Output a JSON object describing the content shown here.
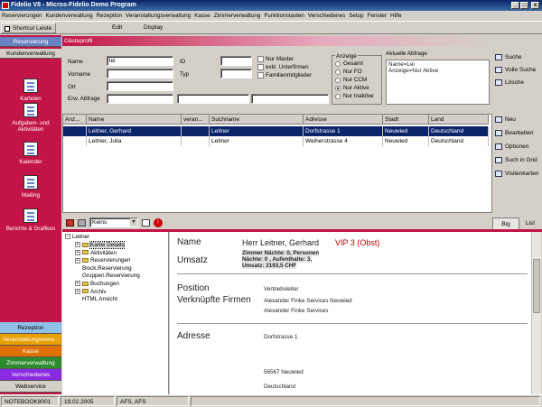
{
  "window": {
    "title": "Fidelio V8 - Micros-Fidelio Demo Program",
    "minimize": "_",
    "maximize": "□",
    "close": "x"
  },
  "menu": [
    "Reservierungen",
    "Kundenverwaltung",
    "Rezeption",
    "Veranstaltungsverwaltung",
    "Kasse",
    "Zimmerverwaltung",
    "Funktionstasten",
    "Verschiedenes",
    "Setup",
    "Fenster",
    "Hilfe"
  ],
  "toolbar": {
    "shortcut": "Shortcut Leiste",
    "edit": "Edit",
    "display": "Display"
  },
  "nav": {
    "top_tabs": [
      "Reservierung",
      "Kundenverwaltung"
    ],
    "items": [
      "Karteien",
      "Aufgaben- und Aktivitäten",
      "Kalender",
      "Mailing",
      "Berichte & Grafiken"
    ],
    "bottom_tabs": [
      {
        "label": "Rezeption",
        "color": "#8fc0e8"
      },
      {
        "label": "Veranstaltungsverw...",
        "color": "#e8a000"
      },
      {
        "label": "Kasse",
        "color": "#e07000"
      },
      {
        "label": "Zimmerverwaltung",
        "color": "#2e8b2e"
      },
      {
        "label": "Verschiedenes",
        "color": "#8a2be2"
      },
      {
        "label": "Webservice",
        "color": "#d4d0c8"
      }
    ]
  },
  "panel": {
    "title": "Gästeprofil"
  },
  "form": {
    "name_label": "Name",
    "name_value": "lei",
    "vorname_label": "Vorname",
    "ort_label": "Ort",
    "erw_label": "Erw. Abfrage",
    "id_label": "ID",
    "typ_label": "Typ",
    "checks": [
      "Nur Master",
      "exkl. Unterfirmen",
      "Familienmitglieder"
    ],
    "anzeige_title": "Anzeige",
    "anzeige_options": [
      "Gesamt",
      "Nur FO",
      "Nur CCM",
      "Nur Aktive",
      "Nur Inaktive"
    ],
    "anzeige_selected": 3,
    "aktuelle_title": "Aktuelle Abfrage",
    "aktuelle_lines": [
      "Name=Lei",
      "Anzeige=Nur Aktive"
    ]
  },
  "search_buttons": [
    "Suche",
    "Volle Suche",
    "Lösche"
  ],
  "grid": {
    "columns": [
      "Anz...",
      "Name",
      "veran...",
      "Suchname",
      "Adresse",
      "Stadt",
      "Land"
    ],
    "rows": [
      [
        "",
        "Leitner, Gerhard",
        "",
        "Leitner",
        "Dorfstrasse 1",
        "Neuwied",
        "Deutschland"
      ],
      [
        "",
        "Leitner, Julia",
        "",
        "Leitner",
        "Weiherstrasse 4",
        "Neuwied",
        "Deutschland"
      ]
    ],
    "selected": 0
  },
  "grid_buttons": [
    "Neu",
    "Bearbeiten",
    "Optionen",
    "Such in Grid",
    "Visitenkarten"
  ],
  "lower": {
    "combo_value": "Keins",
    "tab_big": "Big",
    "tab_list": "List"
  },
  "tree": {
    "root": "Leitner",
    "nodes": [
      {
        "label": "Kartei Details",
        "indent": 1,
        "toggle": "+",
        "folder": true,
        "selected": true
      },
      {
        "label": "Aktivitäten",
        "indent": 1,
        "toggle": "+",
        "folder": true
      },
      {
        "label": "Reservierungen",
        "indent": 1,
        "toggle": "+",
        "folder": true
      },
      {
        "label": "Block.Reservierung",
        "indent": 2
      },
      {
        "label": "Gruppen.Reservierung",
        "indent": 2
      },
      {
        "label": "Buchungen",
        "indent": 1,
        "toggle": "+",
        "folder": true
      },
      {
        "label": "Archiv",
        "indent": 1,
        "toggle": "+",
        "folder": true
      },
      {
        "label": "HTML Ansicht",
        "indent": 2
      }
    ]
  },
  "detail": {
    "name_label": "Name",
    "name_value": "Herr Leitner, Gerhard",
    "vip": "VIP 3 (Obst)",
    "umsatz_label": "Umsatz",
    "umsatz_lines": [
      "Zimmer Nächte: 0, Personen",
      "Nächte: 0 , Aufenthalte: 3,",
      "Umsatz: 2193,5 CHF"
    ],
    "position_label": "Position",
    "position_value": "Vertriebsleiter",
    "firmen_label": "Verknüpfte Firmen",
    "firmen_values": [
      "Alexander Finke Services Neuwied",
      "Alexander Finke Services"
    ],
    "adresse_label": "Adresse",
    "adresse_lines": [
      "Dorfstrasse 1",
      "56567 Neuwied",
      "Deutschland"
    ]
  },
  "status": {
    "computer": "NOTEBOOK8001",
    "date": "19.02.2005",
    "users": "AFS, AFS"
  }
}
